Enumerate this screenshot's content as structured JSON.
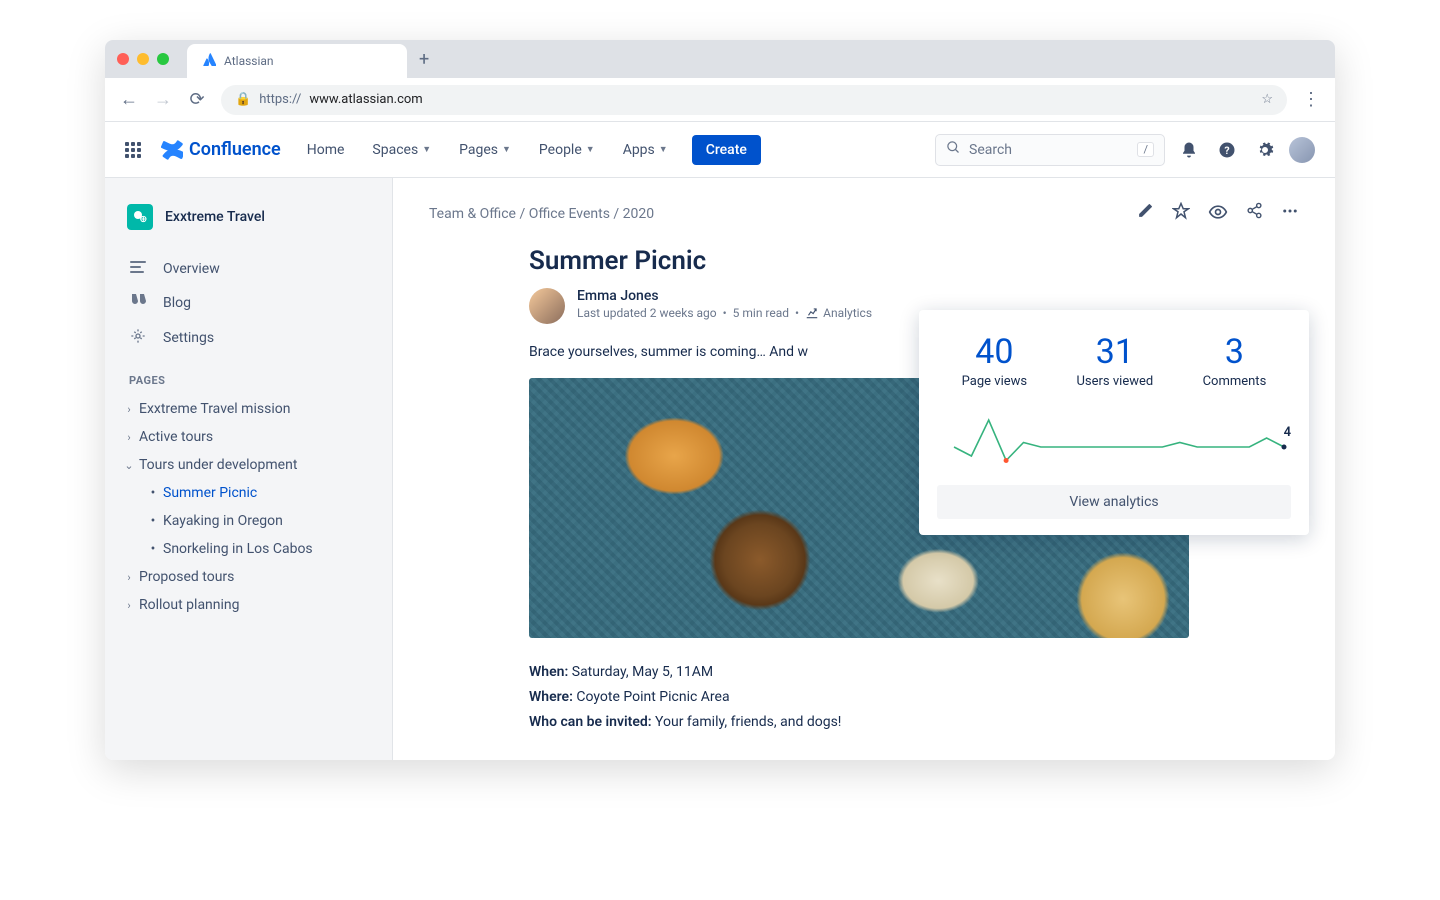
{
  "browser": {
    "tab_title": "Atlassian",
    "url_prefix": "https:// ",
    "url_host": "www.atlassian.com"
  },
  "nav": {
    "product": "Confluence",
    "home": "Home",
    "spaces": "Spaces",
    "pages": "Pages",
    "people": "People",
    "apps": "Apps",
    "create": "Create",
    "search_placeholder": "Search",
    "search_key": "/"
  },
  "sidebar": {
    "space": "Exxtreme Travel",
    "overview": "Overview",
    "blog": "Blog",
    "settings": "Settings",
    "pages_hdr": "PAGES",
    "tree": [
      {
        "label": "Exxtreme Travel mission",
        "exp": false
      },
      {
        "label": "Active tours",
        "exp": false
      },
      {
        "label": "Tours under development",
        "exp": true,
        "children": [
          {
            "label": "Summer Picnic",
            "active": true
          },
          {
            "label": "Kayaking in Oregon"
          },
          {
            "label": "Snorkeling in Los Cabos"
          }
        ]
      },
      {
        "label": "Proposed tours",
        "exp": false
      },
      {
        "label": "Rollout planning",
        "exp": false
      }
    ]
  },
  "page": {
    "crumbs": "Team & Office / Office Events / 2020",
    "title": "Summer Picnic",
    "author": "Emma Jones",
    "updated": "Last updated 2 weeks ago",
    "read": "5 min read",
    "analytics_label": "Analytics",
    "intro": "Brace yourselves, summer is coming… And w",
    "when_l": "When:",
    "when_v": " Saturday, May 5, 11AM",
    "where_l": "Where:",
    "where_v": " Coyote Point Picnic Area",
    "who_l": "Who can be invited:",
    "who_v": " Your family, friends, and dogs!"
  },
  "analytics": {
    "views_n": "40",
    "views_l": "Page views",
    "users_n": "31",
    "users_l": "Users viewed",
    "comm_n": "3",
    "comm_l": "Comments",
    "current": "4",
    "cta": "View analytics"
  },
  "chart_data": {
    "type": "line",
    "title": "Page views over time",
    "x": [
      0,
      1,
      2,
      3,
      4,
      5,
      6,
      7,
      8,
      9,
      10,
      11,
      12,
      13,
      14,
      15,
      16,
      17,
      18,
      19
    ],
    "values": [
      4,
      2,
      10,
      1,
      5,
      4,
      4,
      4,
      4,
      4,
      4,
      4,
      4,
      5,
      4,
      4,
      4,
      4,
      6,
      4
    ],
    "ylim": [
      0,
      12
    ],
    "current_label": 4
  }
}
